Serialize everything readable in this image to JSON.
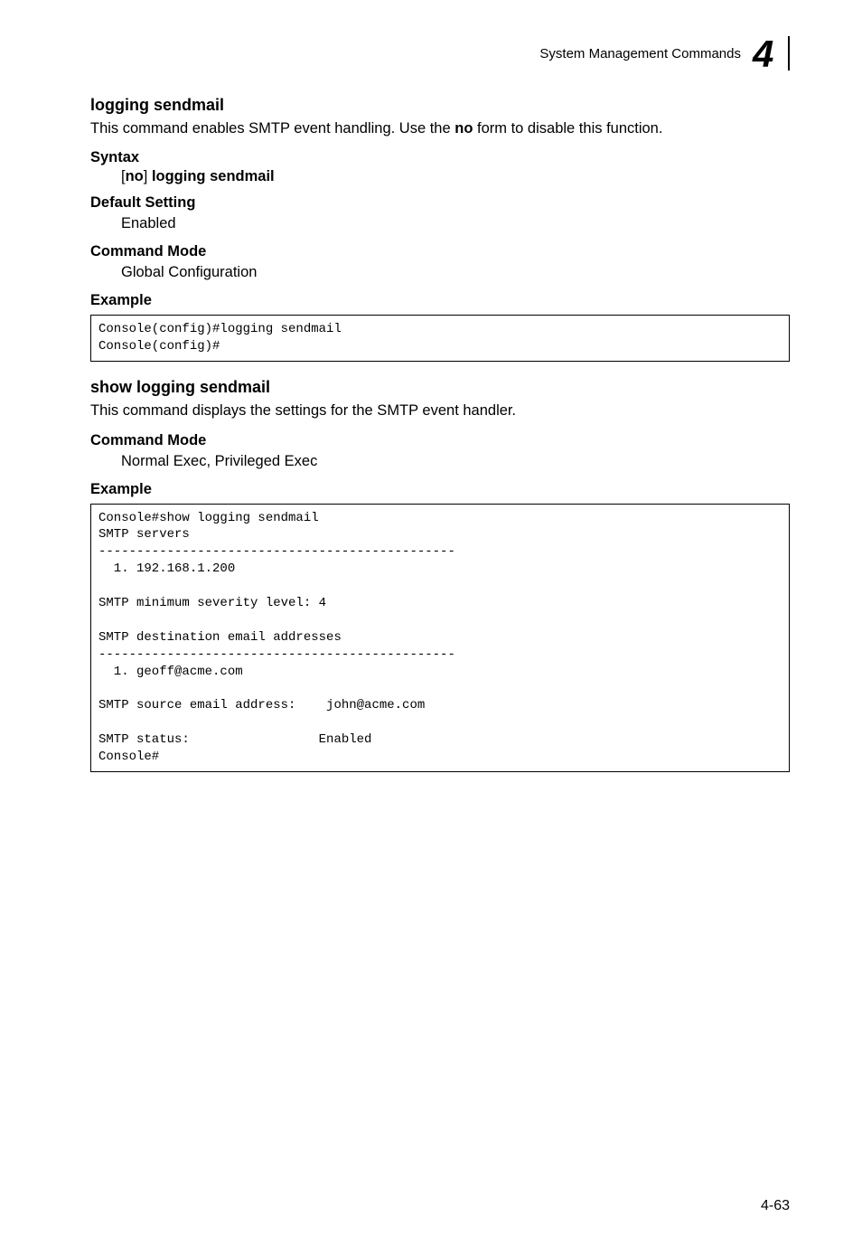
{
  "header": {
    "chapter_title": "System Management Commands",
    "chapter_number": "4"
  },
  "section1": {
    "title": "logging sendmail",
    "desc_part1": "This command enables SMTP event handling. Use the ",
    "desc_bold": "no",
    "desc_part2": " form to disable this function.",
    "syntax_label": "Syntax",
    "syntax_bracket_open": "[",
    "syntax_no": "no",
    "syntax_bracket_close": "] ",
    "syntax_cmd": "logging sendmail",
    "default_label": "Default Setting",
    "default_value": "Enabled",
    "mode_label": "Command Mode",
    "mode_value": "Global Configuration",
    "example_label": "Example",
    "example_code": "Console(config)#logging sendmail\nConsole(config)#"
  },
  "section2": {
    "title": "show logging sendmail",
    "desc": "This command displays the settings for the SMTP event handler.",
    "mode_label": "Command Mode",
    "mode_value": "Normal Exec, Privileged Exec",
    "example_label": "Example",
    "example_code": "Console#show logging sendmail\nSMTP servers\n-----------------------------------------------\n  1. 192.168.1.200\n\nSMTP minimum severity level: 4\n\nSMTP destination email addresses\n-----------------------------------------------\n  1. geoff@acme.com\n\nSMTP source email address:    john@acme.com\n\nSMTP status:                 Enabled\nConsole#"
  },
  "page_number": "4-63"
}
